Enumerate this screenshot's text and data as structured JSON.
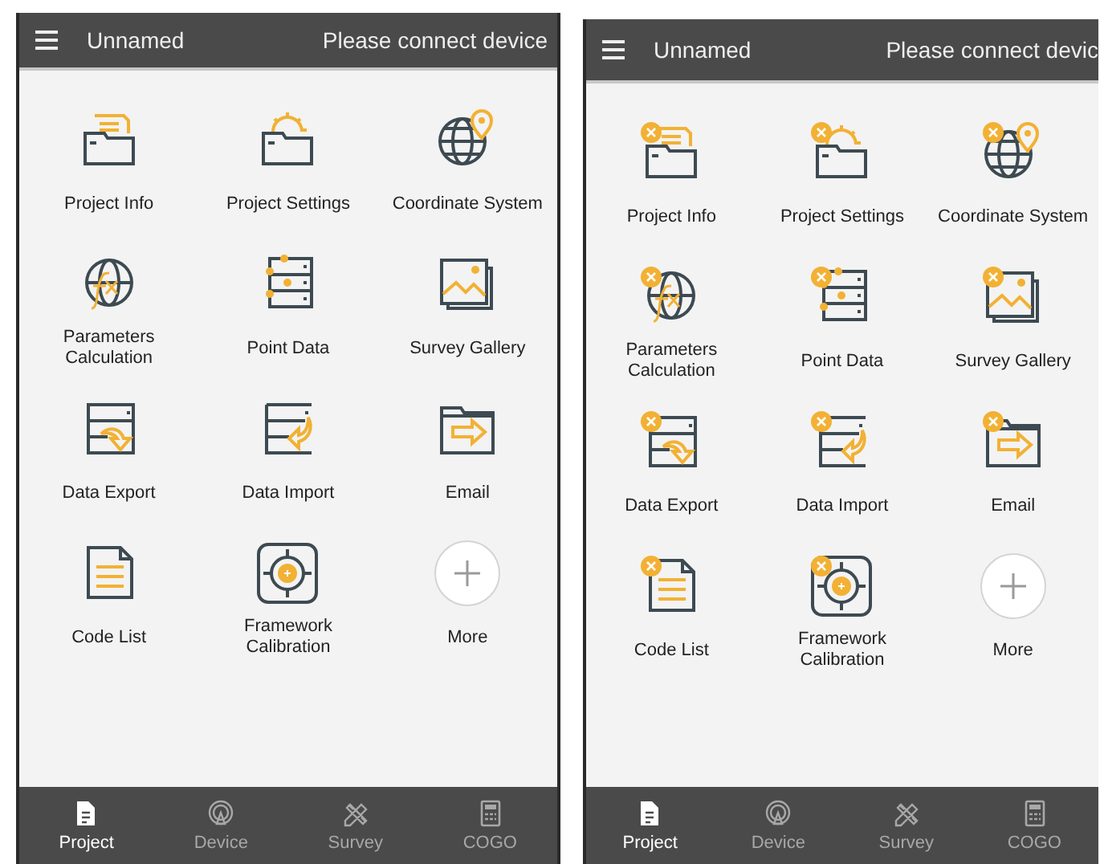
{
  "screens": [
    {
      "title": "Unnamed",
      "status": "Please connect device",
      "items": [
        {
          "kind": "project-info",
          "label": "Project Info",
          "removable": false
        },
        {
          "kind": "project-settings",
          "label": "Project Settings",
          "removable": false
        },
        {
          "kind": "coordinate-system",
          "label": "Coordinate System",
          "removable": false
        },
        {
          "kind": "parameters",
          "label": "Parameters Calculation",
          "removable": false
        },
        {
          "kind": "point-data",
          "label": "Point Data",
          "removable": false
        },
        {
          "kind": "gallery",
          "label": "Survey Gallery",
          "removable": false
        },
        {
          "kind": "data-export",
          "label": "Data Export",
          "removable": false
        },
        {
          "kind": "data-import",
          "label": "Data Import",
          "removable": false
        },
        {
          "kind": "email",
          "label": "Email",
          "removable": false
        },
        {
          "kind": "code-list",
          "label": "Code List",
          "removable": false
        },
        {
          "kind": "calibration",
          "label": "Framework Calibration",
          "removable": false
        },
        {
          "kind": "more",
          "label": "More",
          "removable": false
        }
      ],
      "nav": [
        {
          "kind": "project",
          "label": "Project",
          "selected": true
        },
        {
          "kind": "device",
          "label": "Device",
          "selected": false
        },
        {
          "kind": "survey",
          "label": "Survey",
          "selected": false
        },
        {
          "kind": "cogo",
          "label": "COGO",
          "selected": false
        }
      ]
    },
    {
      "title": "Unnamed",
      "status": "Please connect devic",
      "items": [
        {
          "kind": "project-info",
          "label": "Project Info",
          "removable": true
        },
        {
          "kind": "project-settings",
          "label": "Project Settings",
          "removable": true
        },
        {
          "kind": "coordinate-system",
          "label": "Coordinate System",
          "removable": true
        },
        {
          "kind": "parameters",
          "label": "Parameters Calculation",
          "removable": true
        },
        {
          "kind": "point-data",
          "label": "Point Data",
          "removable": true
        },
        {
          "kind": "gallery",
          "label": "Survey Gallery",
          "removable": true
        },
        {
          "kind": "data-export",
          "label": "Data Export",
          "removable": true
        },
        {
          "kind": "data-import",
          "label": "Data Import",
          "removable": true
        },
        {
          "kind": "email",
          "label": "Email",
          "removable": true
        },
        {
          "kind": "code-list",
          "label": "Code List",
          "removable": true
        },
        {
          "kind": "calibration",
          "label": "Framework Calibration",
          "removable": true
        },
        {
          "kind": "more",
          "label": "More",
          "removable": false
        }
      ],
      "nav": [
        {
          "kind": "project",
          "label": "Project",
          "selected": true
        },
        {
          "kind": "device",
          "label": "Device",
          "selected": false
        },
        {
          "kind": "survey",
          "label": "Survey",
          "selected": false
        },
        {
          "kind": "cogo",
          "label": "COGO",
          "selected": false
        }
      ]
    }
  ]
}
